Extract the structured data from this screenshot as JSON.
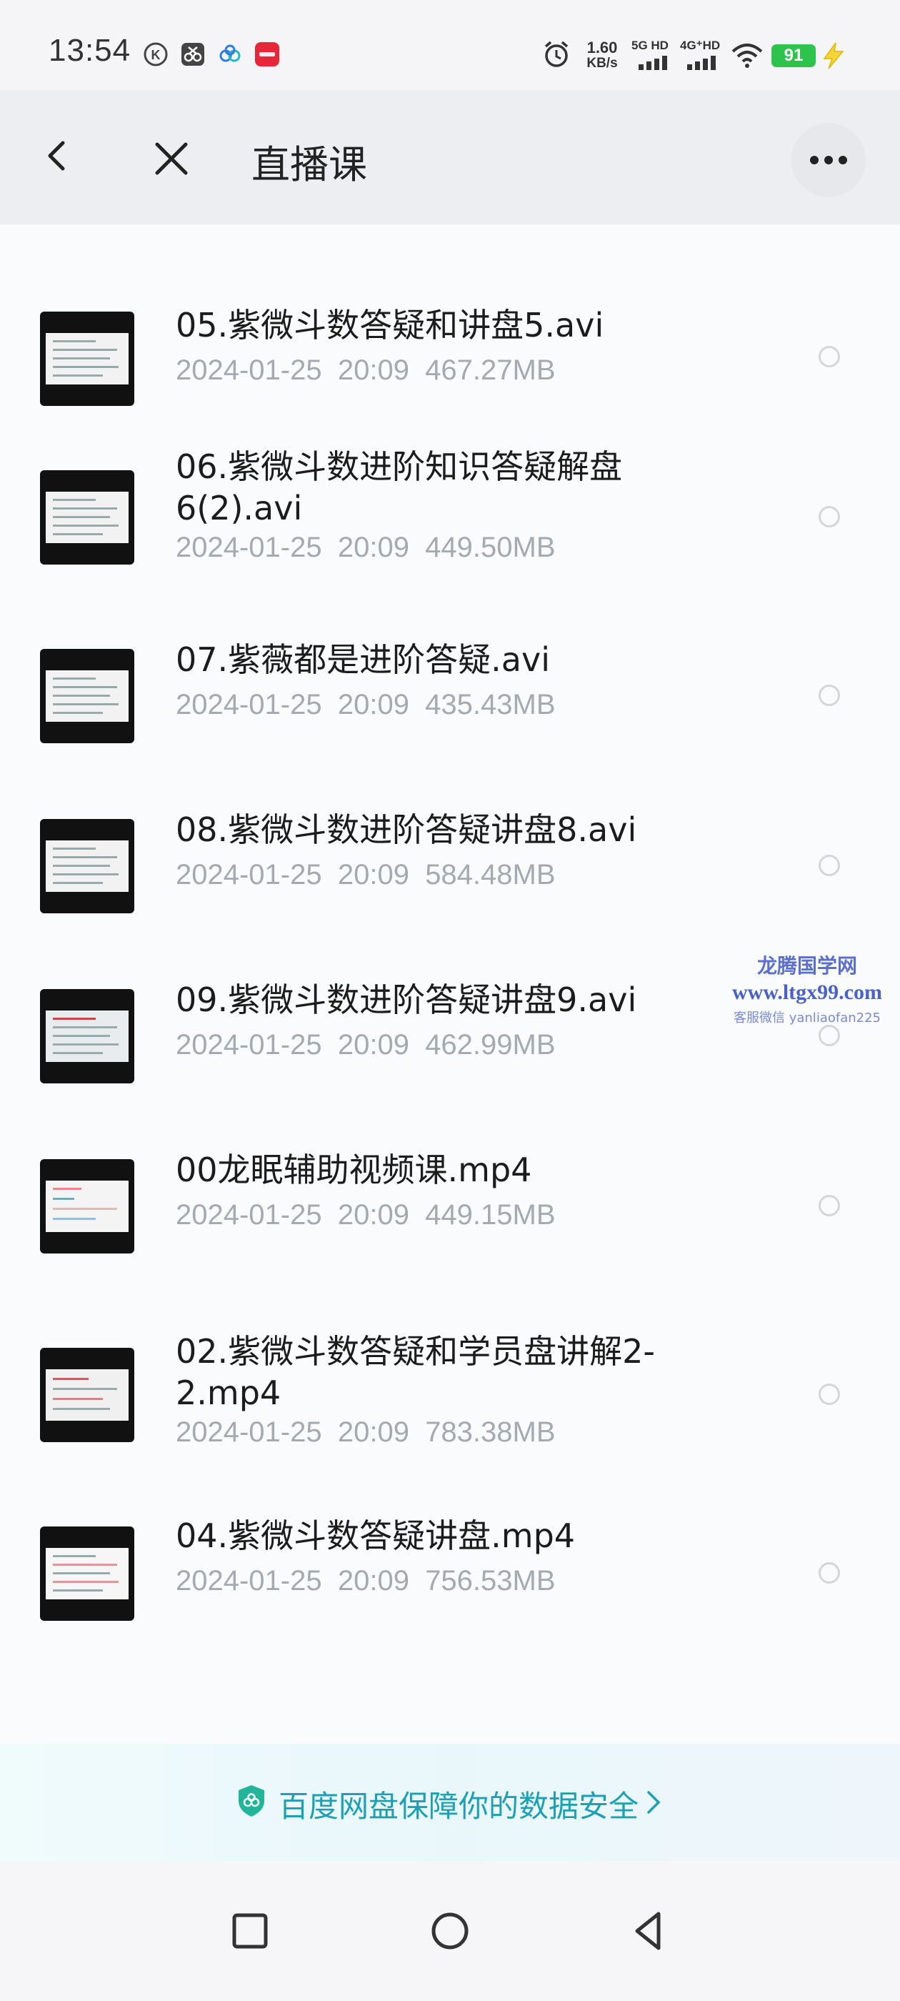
{
  "status_bar": {
    "time": "13:54",
    "speed_value": "1.60",
    "speed_unit": "KB/s",
    "net1": "5G HD",
    "net2": "4G⁺HD",
    "battery": "91",
    "icons": [
      "k-circle-icon",
      "scissors-app-icon",
      "baidu-cloud-app-icon",
      "xiaohongshu-app-icon",
      "alarm-icon",
      "signal-icon",
      "wifi-icon",
      "charging-icon"
    ]
  },
  "header": {
    "title": "直播课",
    "back_icon": "chevron-left-icon",
    "close_icon": "close-icon",
    "more_icon": "more-horizontal-icon"
  },
  "files": [
    {
      "name": "05.紫微斗数答疑和讲盘5.avi",
      "date": "2024-01-25",
      "time": "20:09",
      "size": "467.27MB"
    },
    {
      "name": "06.紫微斗数进阶知识答疑解盘6(2).avi",
      "date": "2024-01-25",
      "time": "20:09",
      "size": "449.50MB"
    },
    {
      "name": "07.紫薇都是进阶答疑.avi",
      "date": "2024-01-25",
      "time": "20:09",
      "size": "435.43MB"
    },
    {
      "name": "08.紫微斗数进阶答疑讲盘8.avi",
      "date": "2024-01-25",
      "time": "20:09",
      "size": "584.48MB"
    },
    {
      "name": "09.紫微斗数进阶答疑讲盘9.avi",
      "date": "2024-01-25",
      "time": "20:09",
      "size": "462.99MB"
    },
    {
      "name": "00龙眠辅助视频课.mp4",
      "date": "2024-01-25",
      "time": "20:09",
      "size": "449.15MB"
    },
    {
      "name": "02.紫微斗数答疑和学员盘讲解2-2.mp4",
      "date": "2024-01-25",
      "time": "20:09",
      "size": "783.38MB"
    },
    {
      "name": "04.紫微斗数答疑讲盘.mp4",
      "date": "2024-01-25",
      "time": "20:09",
      "size": "756.53MB"
    }
  ],
  "watermark": {
    "title": "龙腾国学网",
    "url": "www.ltgx99.com",
    "contact": "客服微信 yanliaofan225"
  },
  "security_banner": {
    "text": "百度网盘保障你的数据安全",
    "icon": "shield-icon"
  },
  "nav_bar": {
    "icons": [
      "recent-apps-icon",
      "home-icon",
      "back-icon"
    ]
  },
  "colors": {
    "accent": "#1ea0b4",
    "battery": "#2ec34d",
    "meta_text": "#a5a9b0"
  }
}
